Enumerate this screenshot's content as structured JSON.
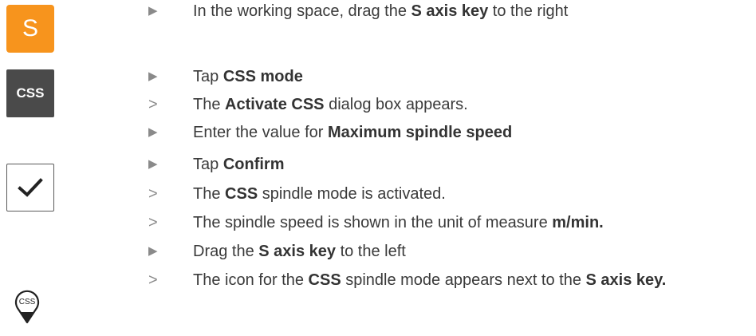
{
  "icons": {
    "s_key_label": "S",
    "css_key_label": "CSS",
    "pin_label": "CSS"
  },
  "steps": [
    {
      "type": "action",
      "marker": "▶",
      "parts": [
        {
          "text": "In the working space, drag the ",
          "bold": false
        },
        {
          "text": "S axis key",
          "bold": true
        },
        {
          "text": " to the right",
          "bold": false
        }
      ]
    },
    {
      "type": "action",
      "marker": "▶",
      "parts": [
        {
          "text": "Tap ",
          "bold": false
        },
        {
          "text": "CSS mode",
          "bold": true
        }
      ]
    },
    {
      "type": "result",
      "marker": ">",
      "parts": [
        {
          "text": "The ",
          "bold": false
        },
        {
          "text": "Activate CSS",
          "bold": true
        },
        {
          "text": " dialog box appears.",
          "bold": false
        }
      ]
    },
    {
      "type": "action",
      "marker": "▶",
      "parts": [
        {
          "text": "Enter the value for ",
          "bold": false
        },
        {
          "text": "Maximum spindle speed",
          "bold": true
        }
      ]
    },
    {
      "type": "action",
      "marker": "▶",
      "parts": [
        {
          "text": "Tap ",
          "bold": false
        },
        {
          "text": "Confirm",
          "bold": true
        }
      ]
    },
    {
      "type": "result",
      "marker": ">",
      "parts": [
        {
          "text": "The ",
          "bold": false
        },
        {
          "text": "CSS",
          "bold": true
        },
        {
          "text": " spindle mode is activated.",
          "bold": false
        }
      ]
    },
    {
      "type": "result",
      "marker": ">",
      "parts": [
        {
          "text": "The spindle speed is shown in the unit of measure ",
          "bold": false
        },
        {
          "text": "m/min.",
          "bold": true
        }
      ]
    },
    {
      "type": "action",
      "marker": "▶",
      "parts": [
        {
          "text": "Drag the ",
          "bold": false
        },
        {
          "text": "S axis key",
          "bold": true
        },
        {
          "text": " to the left",
          "bold": false
        }
      ]
    },
    {
      "type": "result",
      "marker": ">",
      "parts": [
        {
          "text": "The icon for the ",
          "bold": false
        },
        {
          "text": "CSS",
          "bold": true
        },
        {
          "text": " spindle mode appears next to the ",
          "bold": false
        },
        {
          "text": "S axis key.",
          "bold": true
        }
      ]
    }
  ]
}
